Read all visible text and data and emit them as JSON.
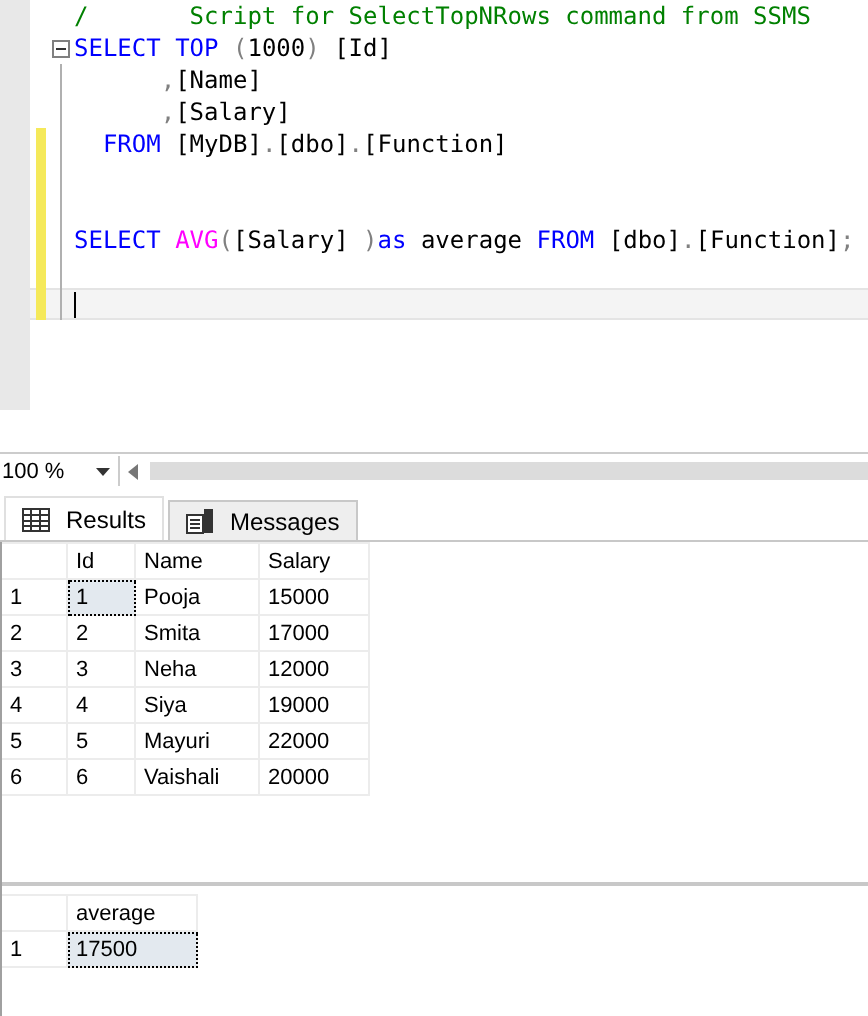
{
  "editor": {
    "lines": [
      {
        "tokens": [
          {
            "kind": "comment",
            "text": "/       Script for SelectTopNRows command from SSMS"
          }
        ]
      },
      {
        "collapsible": true,
        "tokens": [
          {
            "kind": "keyword",
            "text": "SELECT"
          },
          {
            "kind": "keyword",
            "text": " TOP"
          },
          {
            "kind": "punct",
            "text": " ("
          },
          {
            "kind": "text",
            "text": "1000"
          },
          {
            "kind": "punct",
            "text": ")"
          },
          {
            "kind": "text",
            "text": " [Id]"
          }
        ]
      },
      {
        "tokens": [
          {
            "kind": "punct",
            "text": "      ,"
          },
          {
            "kind": "text",
            "text": "[Name]"
          }
        ]
      },
      {
        "tokens": [
          {
            "kind": "punct",
            "text": "      ,"
          },
          {
            "kind": "text",
            "text": "[Salary]"
          }
        ]
      },
      {
        "changed": true,
        "tokens": [
          {
            "kind": "keyword",
            "text": "  FROM"
          },
          {
            "kind": "text",
            "text": " [MyDB]"
          },
          {
            "kind": "punct",
            "text": "."
          },
          {
            "kind": "text",
            "text": "[dbo]"
          },
          {
            "kind": "punct",
            "text": "."
          },
          {
            "kind": "text",
            "text": "[Function]"
          }
        ]
      },
      {
        "changed": true
      },
      {
        "changed": true
      },
      {
        "changed": true,
        "tokens": [
          {
            "kind": "keyword",
            "text": "SELECT"
          },
          {
            "kind": "function",
            "text": " AVG"
          },
          {
            "kind": "punct",
            "text": "("
          },
          {
            "kind": "text",
            "text": "[Salary] "
          },
          {
            "kind": "punct",
            "text": ")"
          },
          {
            "kind": "keyword",
            "text": "as"
          },
          {
            "kind": "text",
            "text": " average "
          },
          {
            "kind": "keyword",
            "text": "FROM"
          },
          {
            "kind": "text",
            "text": " [dbo]"
          },
          {
            "kind": "punct",
            "text": "."
          },
          {
            "kind": "text",
            "text": "[Function]"
          },
          {
            "kind": "punct",
            "text": ";"
          }
        ]
      },
      {
        "changed": true
      },
      {
        "changed": true,
        "current": true
      }
    ]
  },
  "zoom": {
    "value": "100 %"
  },
  "tabs": [
    {
      "kind": "grid",
      "label": "Results",
      "selected": true
    },
    {
      "kind": "messages",
      "label": "Messages",
      "selected": false
    }
  ],
  "grids": [
    {
      "columns": [
        "Id",
        "Name",
        "Salary"
      ],
      "rows": [
        {
          "number": "1",
          "cells": [
            {
              "text": "1",
              "selected": true
            },
            {
              "text": "Pooja",
              "selected": false
            },
            {
              "text": "15000",
              "selected": false
            }
          ]
        },
        {
          "number": "2",
          "cells": [
            {
              "text": "2",
              "selected": false
            },
            {
              "text": "Smita",
              "selected": false
            },
            {
              "text": "17000",
              "selected": false
            }
          ]
        },
        {
          "number": "3",
          "cells": [
            {
              "text": "3",
              "selected": false
            },
            {
              "text": "Neha",
              "selected": false
            },
            {
              "text": "12000",
              "selected": false
            }
          ]
        },
        {
          "number": "4",
          "cells": [
            {
              "text": "4",
              "selected": false
            },
            {
              "text": "Siya",
              "selected": false
            },
            {
              "text": "19000",
              "selected": false
            }
          ]
        },
        {
          "number": "5",
          "cells": [
            {
              "text": "5",
              "selected": false
            },
            {
              "text": "Mayuri",
              "selected": false
            },
            {
              "text": "22000",
              "selected": false
            }
          ]
        },
        {
          "number": "6",
          "cells": [
            {
              "text": "6",
              "selected": false
            },
            {
              "text": "Vaishali",
              "selected": false
            },
            {
              "text": "20000",
              "selected": false
            }
          ]
        }
      ]
    },
    {
      "columns": [
        "average"
      ],
      "rows": [
        {
          "number": "1",
          "cells": [
            {
              "text": "17500",
              "selected": true
            }
          ]
        }
      ]
    }
  ]
}
